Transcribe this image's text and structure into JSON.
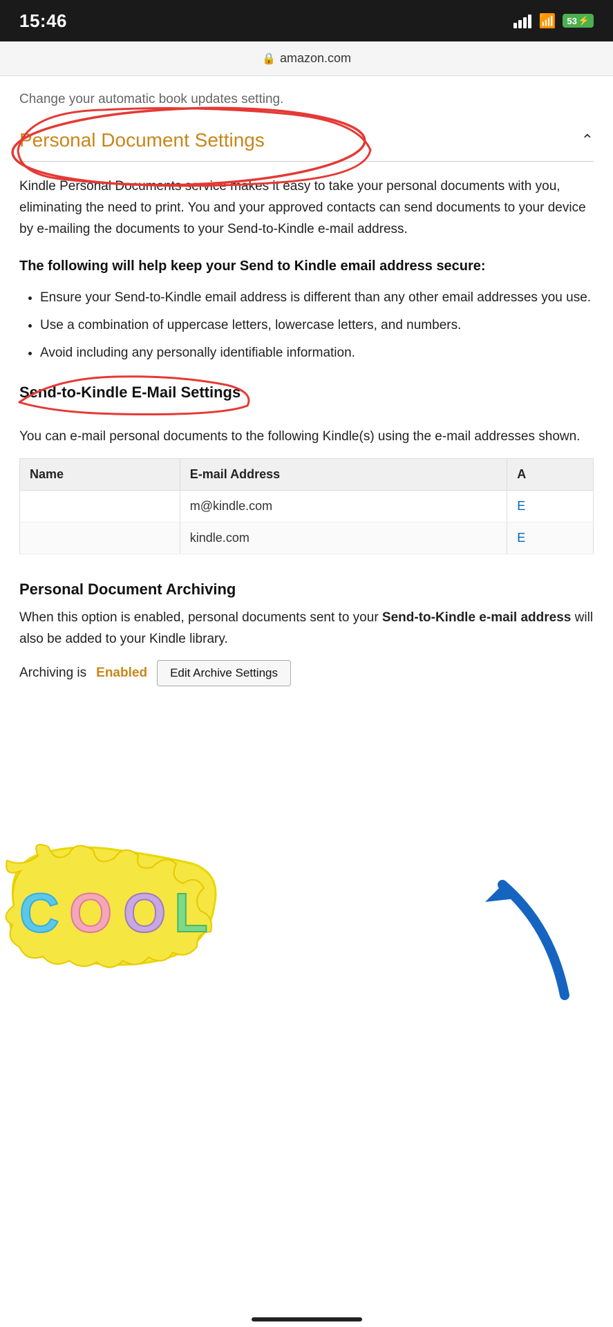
{
  "status_bar": {
    "time": "15:46",
    "battery": "53",
    "battery_charging": true
  },
  "url_bar": {
    "url": "amazon.com",
    "secure": true
  },
  "page": {
    "subtitle": "Change your automatic book updates setting.",
    "personal_doc_section": {
      "title": "Personal Document Settings",
      "description": "Kindle Personal Documents service makes it easy to take your personal documents with you, eliminating the need to print. You and your approved contacts can send documents to your device by e-mailing the documents to your Send-to-Kindle e-mail address.",
      "security_heading": "The following will help keep your Send to Kindle email address secure:",
      "bullets": [
        "Ensure your Send-to-Kindle email address is different than any other email addresses you use.",
        "Use a combination of uppercase letters, lowercase letters, and numbers.",
        "Avoid including any personally identifiable information."
      ]
    },
    "send_to_kindle_section": {
      "title": "Send-to-Kindle E-Mail Settings",
      "description": "You can e-mail personal documents to the following Kindle(s) using the e-mail addresses shown.",
      "table": {
        "headers": [
          "Name",
          "E-mail Address",
          "A"
        ],
        "rows": [
          {
            "name": "",
            "email": "m@kindle.com",
            "action": "E"
          },
          {
            "name": "",
            "email": "kindle.com",
            "action": "E"
          }
        ]
      }
    },
    "archiving_section": {
      "title": "Personal Document Archiving",
      "description_part1": "When this option is enabled, personal documents sent to your ",
      "description_bold": "Send-to-Kindle e-mail address",
      "description_part2": " will also be added to your Kindle library.",
      "archiving_label": "Archiving is",
      "archiving_status": "Enabled",
      "edit_button_label": "Edit Archive Settings"
    }
  }
}
